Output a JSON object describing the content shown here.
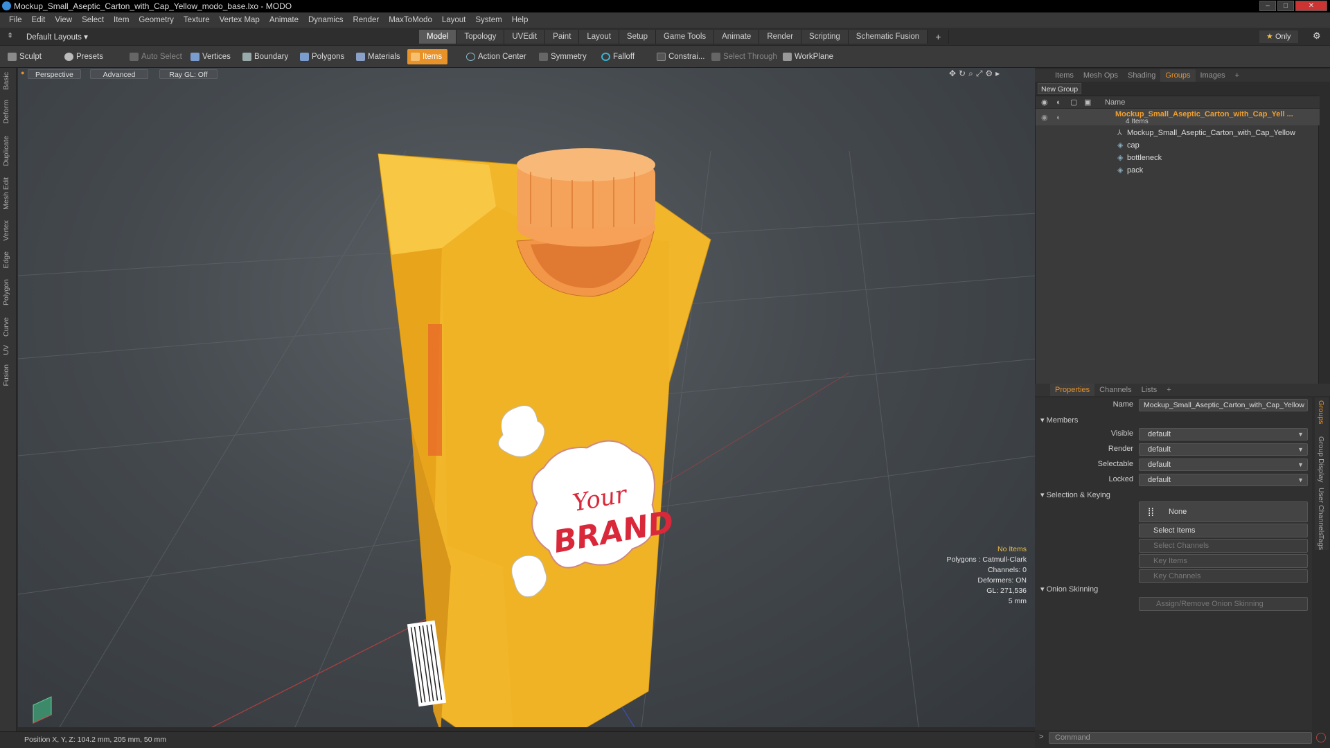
{
  "window": {
    "title": "Mockup_Small_Aseptic_Carton_with_Cap_Yellow_modo_base.lxo - MODO",
    "min": "–",
    "max": "□",
    "close": "✕"
  },
  "menu": [
    "File",
    "Edit",
    "View",
    "Select",
    "Item",
    "Geometry",
    "Texture",
    "Vertex Map",
    "Animate",
    "Dynamics",
    "Render",
    "MaxToModo",
    "Layout",
    "System",
    "Help"
  ],
  "layoutbar": {
    "layouts_label": "Default Layouts",
    "tabs": [
      "Model",
      "Topology",
      "UVEdit",
      "Paint",
      "Layout",
      "Setup",
      "Game Tools",
      "Animate",
      "Render",
      "Scripting",
      "Schematic Fusion"
    ],
    "active_tab": "Model",
    "add": "+",
    "only_label": "Only"
  },
  "toolbar": {
    "sculpt": "Sculpt",
    "presets": "Presets",
    "auto_select": "Auto Select",
    "vertices": "Vertices",
    "boundary": "Boundary",
    "polygons": "Polygons",
    "materials": "Materials",
    "items": "Items",
    "action_center": "Action Center",
    "symmetry": "Symmetry",
    "falloff": "Falloff",
    "constraints": "Constrai...",
    "select_through": "Select Through",
    "workplane": "WorkPlane"
  },
  "left_tabs": [
    "Basic",
    "Deform",
    "Duplicate",
    "Mesh Edit",
    "Vertex",
    "Edge",
    "Polygon",
    "Curve",
    "UV",
    "Fusion"
  ],
  "viewport": {
    "view": "Perspective",
    "shading": "Advanced",
    "raygl": "Ray GL: Off",
    "brand_line1": "Your",
    "brand_line2": "BRAND",
    "info": {
      "no_items": "No Items",
      "polygons": "Polygons : Catmull-Clark",
      "channels": "Channels: 0",
      "deformers": "Deformers: ON",
      "gl": "GL: 271,536",
      "scale": "5 mm"
    }
  },
  "status": {
    "position": "Position X, Y, Z:  104.2 mm, 205 mm, 50 mm"
  },
  "groups_panel": {
    "tabs": [
      "Items",
      "Mesh Ops",
      "Shading",
      "Groups",
      "Images"
    ],
    "active": "Groups",
    "new_group": "New Group",
    "col_name": "Name",
    "group_name": "Mockup_Small_Aseptic_Carton_with_Cap_Yell ...",
    "group_count": "4 Items",
    "members": [
      "Mockup_Small_Aseptic_Carton_with_Cap_Yellow",
      "cap",
      "bottleneck",
      "pack"
    ]
  },
  "properties": {
    "tabs": [
      "Properties",
      "Channels",
      "Lists"
    ],
    "active": "Properties",
    "name_label": "Name",
    "name_value": "Mockup_Small_Aseptic_Carton_with_Cap_Yellow",
    "members_header": "Members",
    "fields": [
      {
        "label": "Visible",
        "value": "default"
      },
      {
        "label": "Render",
        "value": "default"
      },
      {
        "label": "Selectable",
        "value": "default"
      },
      {
        "label": "Locked",
        "value": "default"
      }
    ],
    "sel_header": "Selection & Keying",
    "none": "None",
    "select_items": "Select Items",
    "select_channels": "Select Channels",
    "key_items": "Key Items",
    "key_channels": "Key Channels",
    "onion_header": "Onion Skinning",
    "onion_btn": "Assign/Remove Onion Skinning",
    "side_tabs": [
      "Groups",
      "Group Display",
      "User Channels",
      "Tags"
    ]
  },
  "command": {
    "placeholder": "Command"
  },
  "colors": {
    "accent": "#e8932a",
    "carton": "#f3b62a",
    "cap": "#f08a3e"
  }
}
